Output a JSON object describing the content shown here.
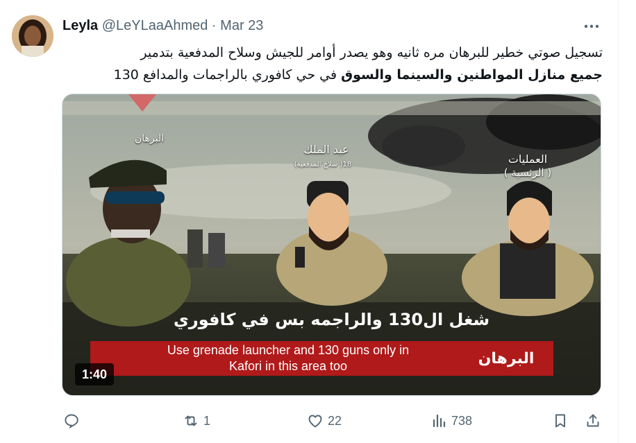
{
  "tweet": {
    "author_name": "Leyla",
    "handle": "@LeYLaaAhmed",
    "separator": "·",
    "date": "Mar 23",
    "text_line1": "تسجيل صوتي خطير للبرهان  مره ثانيه وهو  يصدر أوامر للجيش وسلاح المدفعية بتدمير",
    "text_line2_bold": "جميع منازل المواطنين  والسينما والسوق",
    "text_line2_rest": " في حي كافوري بالراجمات والمدافع 130"
  },
  "video": {
    "label_burhan": "البرهان",
    "label_abdelmalik": "عبد الملك",
    "label_abdelmalik_sub": "18( سلاح المدفعية)",
    "label_operations": "العمليات",
    "label_operations_sub": "( الرئسية )",
    "arabic_subtitle": "شغل ال130 والراجمه بس في كافوري",
    "english_subtitle_line1": "Use grenade launcher and 130 guns only in",
    "english_subtitle_line2": "Kafori in this area too",
    "speaker_box": "البرهان",
    "duration": "1:40"
  },
  "actions": {
    "replies": "",
    "reposts": "1",
    "likes": "22",
    "views": "738"
  },
  "icons": [
    "more-icon",
    "reply-icon",
    "repost-icon",
    "like-icon",
    "views-icon",
    "bookmark-icon",
    "share-icon"
  ],
  "colors": {
    "accent_red": "#b01a1a",
    "muted": "#536471",
    "text": "#0f1419"
  }
}
